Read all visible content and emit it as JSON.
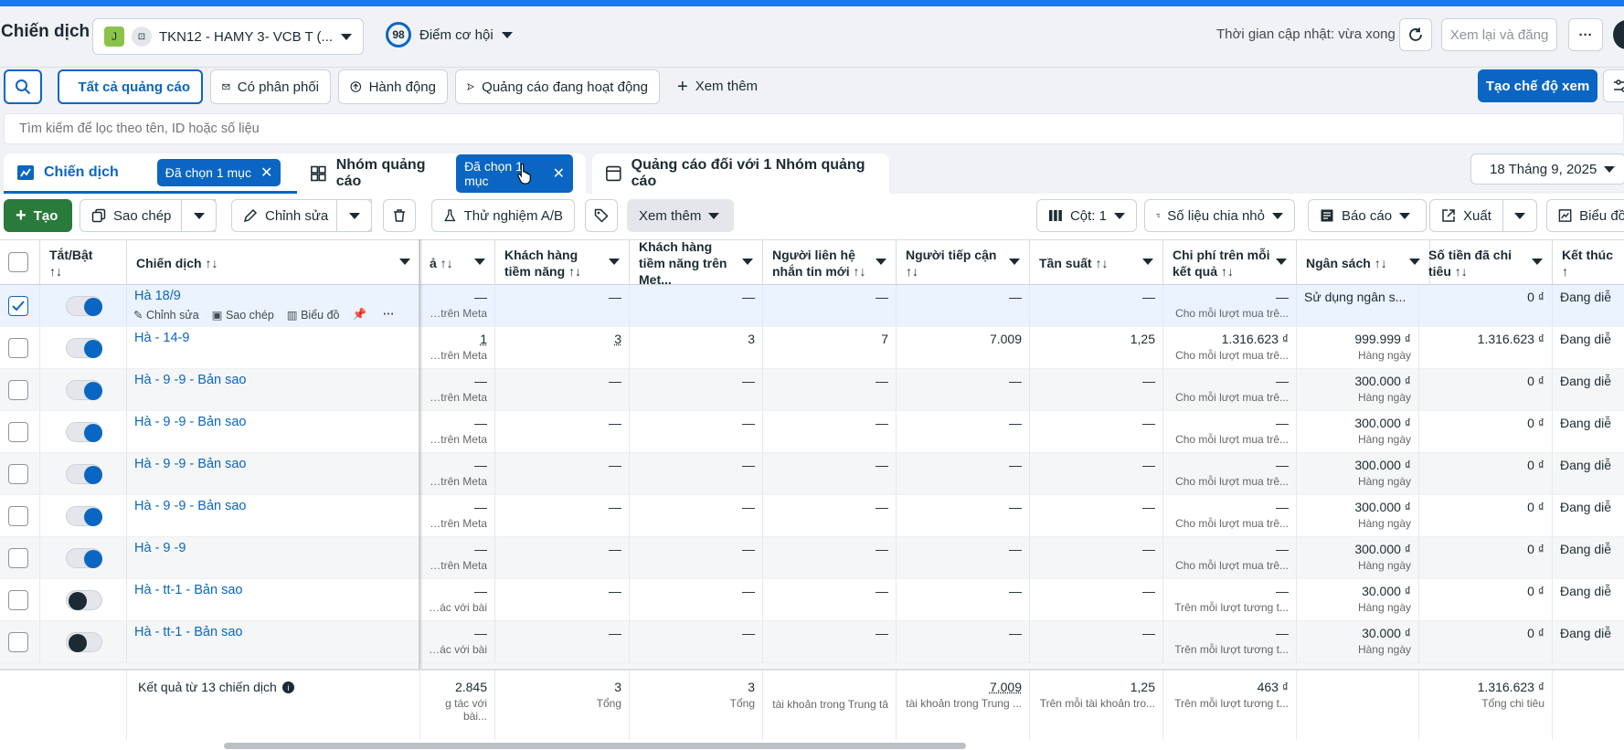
{
  "header": {
    "title": "Chiến dịch",
    "account_badge": "J",
    "account_name": "TKN12 - HAMY 3- VCB T (...",
    "score": "98",
    "score_label": "Điểm cơ hội",
    "update_time": "Thời gian cập nhật: vừa xong",
    "review_publish": "Xem lại và đăng"
  },
  "filters": {
    "all_ads": "Tất cả quảng cáo",
    "delivering": "Có phân phối",
    "actions": "Hành động",
    "active_ads": "Quảng cáo đang hoạt động",
    "more": "Xem thêm",
    "create_view": "Tạo chế độ xem"
  },
  "search": {
    "placeholder": "Tìm kiếm để lọc theo tên, ID hoặc số liệu"
  },
  "tabs": {
    "campaigns": "Chiến dịch",
    "campaigns_pill": "Đã chọn 1 mục",
    "adsets": "Nhóm quảng cáo",
    "adsets_pill": "Đã chọn 1 mục",
    "ads": "Quảng cáo đối với 1 Nhóm quảng cáo",
    "date": "18 Tháng 9, 2025"
  },
  "toolbar": {
    "create": "Tạo",
    "copy": "Sao chép",
    "edit": "Chỉnh sửa",
    "ab_test": "Thử nghiệm A/B",
    "more": "Xem thêm",
    "columns": "Cột: 1",
    "breakdown": "Số liệu chia nhỏ",
    "reports": "Báo cáo",
    "export": "Xuất",
    "charts": "Biểu đồ"
  },
  "columns": {
    "toggle": "Tắt/Bật",
    "toggle_sort": "↑↓",
    "campaign": "Chiến dịch ↑↓",
    "results": "ả ↑↓",
    "potential": "Khách hàng tiềm năng ↑↓",
    "potential_meta": "Khách hàng tiềm năng trên Met...",
    "contacts": "Người liên hệ nhắn tin mới ↑↓",
    "reach": "Người tiếp cận ↑↓",
    "frequency": "Tần suất ↑↓",
    "cost": "Chi phí trên mỗi kết quả ↑↓",
    "budget": "Ngân sách ↑↓",
    "spent": "Số tiền đã chi tiêu ↑↓",
    "end": "Kết thúc ↑"
  },
  "row_actions": {
    "edit": "Chỉnh sửa",
    "copy": "Sao chép",
    "chart": "Biểu đồ"
  },
  "rows": [
    {
      "name": "Hà 18/9",
      "on": true,
      "checked": true,
      "r1": "—",
      "r1s": "ua trên Meta",
      "p": "—",
      "pm": "—",
      "c": "—",
      "re": "—",
      "f": "—",
      "co": "—",
      "cos": "Cho mỗi lượt mua trê...",
      "b": "Sử dụng ngân s...",
      "bs": "",
      "s": "0 ₫",
      "e": "Đang diễ"
    },
    {
      "name": "Hà - 14-9",
      "on": true,
      "checked": false,
      "r1": "1",
      "r1s": "nua trên Meta",
      "p": "3",
      "pm": "3",
      "c": "7",
      "re": "7.009",
      "f": "1,25",
      "co": "1.316.623 ₫",
      "cos": "Cho mỗi lượt mua trê...",
      "b": "999.999 ₫",
      "bs": "Hàng ngày",
      "s": "1.316.623 ₫",
      "e": "Đang diễ"
    },
    {
      "name": "Hà - 9 -9 - Bản sao",
      "on": true,
      "checked": false,
      "r1": "—",
      "r1s": "nua trên Meta",
      "p": "—",
      "pm": "—",
      "c": "—",
      "re": "—",
      "f": "—",
      "co": "—",
      "cos": "Cho mỗi lượt mua trê...",
      "b": "300.000 ₫",
      "bs": "Hàng ngày",
      "s": "0 ₫",
      "e": "Đang diễ"
    },
    {
      "name": "Hà - 9 -9 - Bản sao",
      "on": true,
      "checked": false,
      "r1": "—",
      "r1s": "nua trên Meta",
      "p": "—",
      "pm": "—",
      "c": "—",
      "re": "—",
      "f": "—",
      "co": "—",
      "cos": "Cho mỗi lượt mua trê...",
      "b": "300.000 ₫",
      "bs": "Hàng ngày",
      "s": "0 ₫",
      "e": "Đang diễ"
    },
    {
      "name": "Hà - 9 -9 - Bản sao",
      "on": true,
      "checked": false,
      "r1": "—",
      "r1s": "nua trên Meta",
      "p": "—",
      "pm": "—",
      "c": "—",
      "re": "—",
      "f": "—",
      "co": "—",
      "cos": "Cho mỗi lượt mua trê...",
      "b": "300.000 ₫",
      "bs": "Hàng ngày",
      "s": "0 ₫",
      "e": "Đang diễ"
    },
    {
      "name": "Hà - 9 -9 - Bản sao",
      "on": true,
      "checked": false,
      "r1": "—",
      "r1s": "nua trên Meta",
      "p": "—",
      "pm": "—",
      "c": "—",
      "re": "—",
      "f": "—",
      "co": "—",
      "cos": "Cho mỗi lượt mua trê...",
      "b": "300.000 ₫",
      "bs": "Hàng ngày",
      "s": "0 ₫",
      "e": "Đang diễ"
    },
    {
      "name": "Hà - 9 -9",
      "on": true,
      "checked": false,
      "r1": "—",
      "r1s": "nua trên Meta",
      "p": "—",
      "pm": "—",
      "c": "—",
      "re": "—",
      "f": "—",
      "co": "—",
      "cos": "Cho mỗi lượt mua trê...",
      "b": "300.000 ₫",
      "bs": "Hàng ngày",
      "s": "0 ₫",
      "e": "Đang diễ"
    },
    {
      "name": "Hà - tt-1 - Bản sao",
      "on": false,
      "checked": false,
      "r1": "—",
      "r1s": "g tác với bài ...",
      "p": "—",
      "pm": "—",
      "c": "—",
      "re": "—",
      "f": "—",
      "co": "—",
      "cos": "Trên mỗi lượt tương t...",
      "b": "30.000 ₫",
      "bs": "Hàng ngày",
      "s": "0 ₫",
      "e": "Đang diễ"
    },
    {
      "name": "Hà - tt-1 - Bản sao",
      "on": false,
      "checked": false,
      "r1": "—",
      "r1s": "g tác với bài ...",
      "p": "—",
      "pm": "—",
      "c": "—",
      "re": "—",
      "f": "—",
      "co": "—",
      "cos": "Trên mỗi lượt tương t...",
      "b": "30.000 ₫",
      "bs": "Hàng ngày",
      "s": "0 ₫",
      "e": "Đang diễ"
    }
  ],
  "footer": {
    "label": "Kết quả từ 13 chiến dịch",
    "r1": "2.845",
    "r1s": "g tác với bài...",
    "p": "3",
    "ps": "Tổng",
    "pm": "3",
    "pms": "Tổng",
    "c": "",
    "cs": "tài khoản trong Trung tâ",
    "re": "7.009",
    "res": "tài khoản trong Trung ...",
    "f": "1,25",
    "fs": "Trên mỗi tài khoản tro...",
    "co": "463 ₫",
    "cos": "Trên mỗi lượt tương t...",
    "s": "1.316.623 ₫",
    "ss": "Tổng chi tiêu"
  },
  "colors": {
    "accent": "#0a66c2",
    "create": "#2a7a3b",
    "stripe": "#1877f2"
  }
}
